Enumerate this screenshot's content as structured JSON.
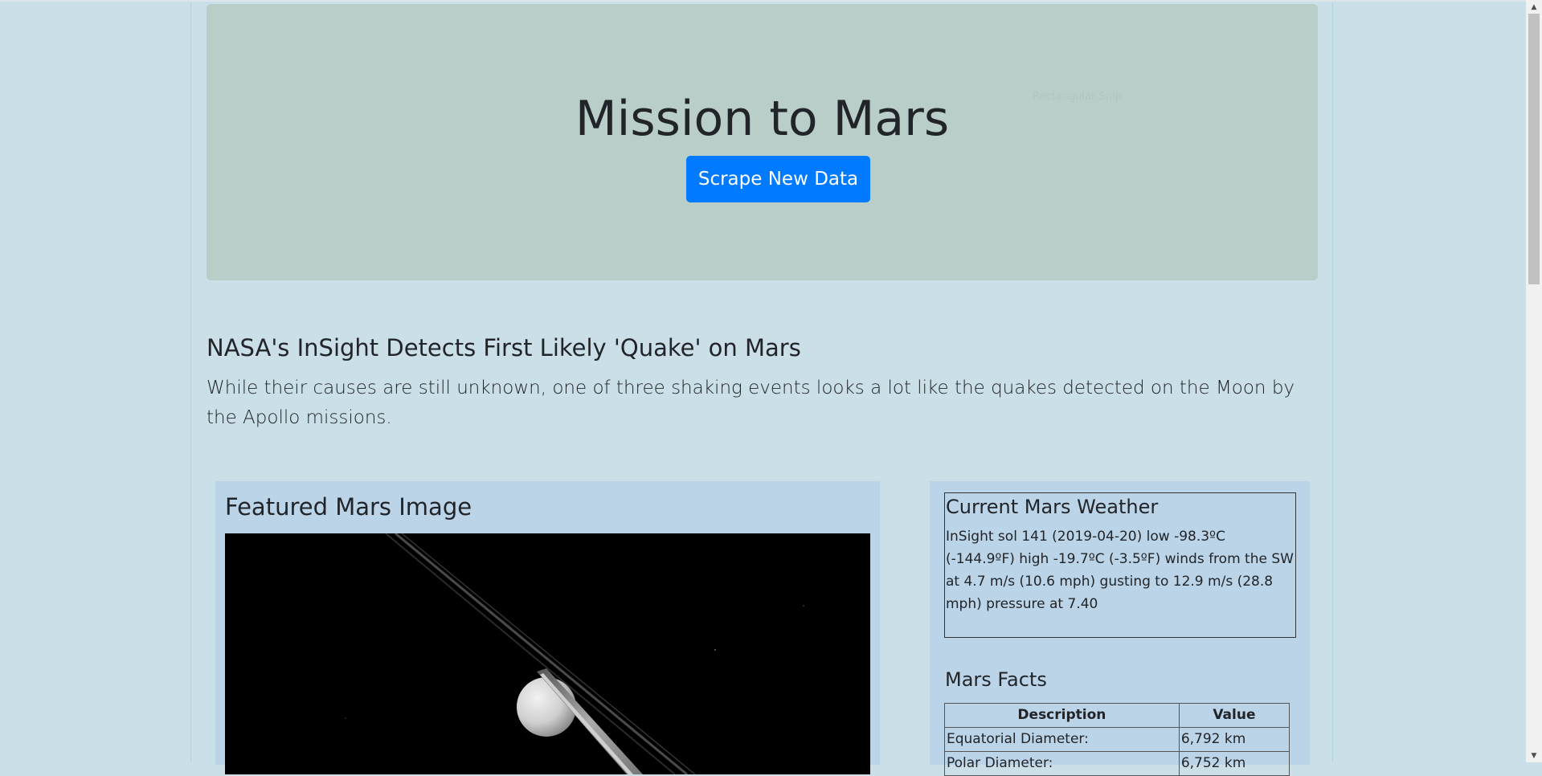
{
  "header": {
    "title": "Mission to Mars",
    "ghost_text": "Rectangular Snip",
    "scrape_button_label": "Scrape New Data"
  },
  "news": {
    "title": "NASA's InSight Detects First Likely 'Quake' on Mars",
    "paragraph": "While their causes are still unknown, one of three shaking events looks a lot like the quakes detected on the Moon by the Apollo missions."
  },
  "featured": {
    "title": "Featured Mars Image"
  },
  "weather": {
    "title": "Current Mars Weather",
    "text": "InSight sol 141 (2019-04-20) low -98.3ºC (-144.9ºF) high -19.7ºC (-3.5ºF) winds from the SW at 4.7 m/s (10.6 mph) gusting to 12.9 m/s (28.8 mph) pressure at 7.40"
  },
  "facts": {
    "title": "Mars Facts",
    "headers": [
      "Description",
      "Value"
    ],
    "rows": [
      [
        "Equatorial Diameter:",
        "6,792 km"
      ],
      [
        "Polar Diameter:",
        "6,752 km"
      ]
    ]
  },
  "colors": {
    "page_background": "#cbdfe9",
    "jumbotron": "#b9cdc9",
    "button": "#007bff",
    "card": "#bcd4e7"
  }
}
